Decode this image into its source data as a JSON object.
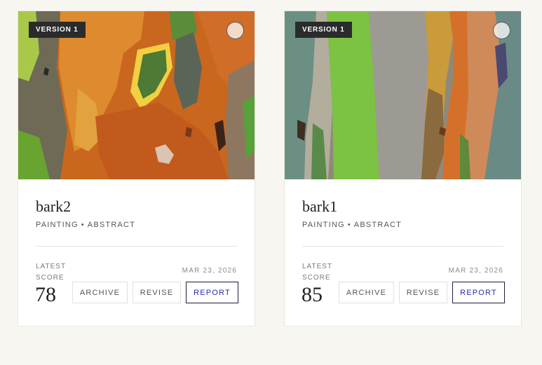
{
  "cards": [
    {
      "badge": "VERSION 1",
      "title": "bark2",
      "medium": "PAINTING",
      "style": "ABSTRACT",
      "score_label": "LATEST SCORE",
      "score": "78",
      "date": "MAR 23, 2026",
      "actions": {
        "archive": "ARCHIVE",
        "revise": "REVISE",
        "report": "REPORT"
      }
    },
    {
      "badge": "VERSION 1",
      "title": "bark1",
      "medium": "PAINTING",
      "style": "ABSTRACT",
      "score_label": "LATEST SCORE",
      "score": "85",
      "date": "MAR 23, 2026",
      "actions": {
        "archive": "ARCHIVE",
        "revise": "REVISE",
        "report": "REPORT"
      }
    }
  ],
  "colors": {
    "page_bg": "#f7f6f1",
    "badge_bg": "#2b2b2b",
    "report_text": "#2a2ab0"
  }
}
